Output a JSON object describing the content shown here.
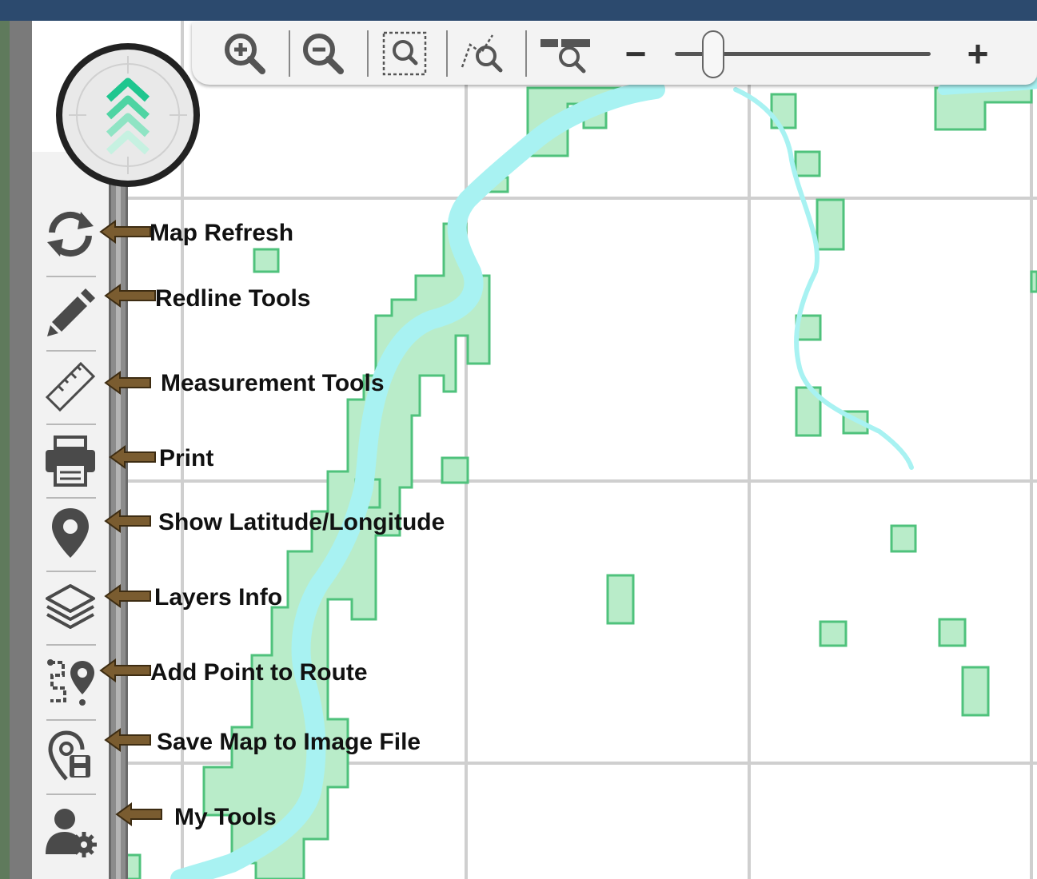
{
  "zoom_toolbar": {
    "buttons": [
      "zoom-in",
      "zoom-out",
      "zoom-to-box",
      "zoom-to-selection",
      "zoom-to-extent"
    ],
    "minus_label": "−",
    "plus_label": "+",
    "zoom_level": 0.15
  },
  "compass": {
    "icon": "north-arrow-chevrons",
    "accent": "#1fc68f"
  },
  "tools": [
    {
      "id": "map-refresh",
      "icon": "refresh-icon",
      "label": "Map Refresh"
    },
    {
      "id": "redline-tools",
      "icon": "pencil-icon",
      "label": "Redline Tools"
    },
    {
      "id": "measurement-tools",
      "icon": "ruler-icon",
      "label": "Measurement Tools"
    },
    {
      "id": "print",
      "icon": "printer-icon",
      "label": "Print"
    },
    {
      "id": "show-lat-long",
      "icon": "map-pin-icon",
      "label": "Show Latitude/Longitude"
    },
    {
      "id": "layers-info",
      "icon": "layers-icon",
      "label": "Layers Info"
    },
    {
      "id": "add-point-to-route",
      "icon": "route-pin-icon",
      "label": "Add Point to Route"
    },
    {
      "id": "save-map-image",
      "icon": "save-map-icon",
      "label": "Save Map to Image File"
    },
    {
      "id": "my-tools",
      "icon": "user-gear-icon",
      "label": "My Tools"
    }
  ],
  "colors": {
    "title_bar": "#2c4a6e",
    "background": "#5f7a5c",
    "water": "#a8f2f2",
    "parcel_fill": "#b9ecc9",
    "parcel_stroke": "#4fc27c",
    "grid": "#cfcfcf",
    "callout_arrow": "#7a5c30"
  }
}
